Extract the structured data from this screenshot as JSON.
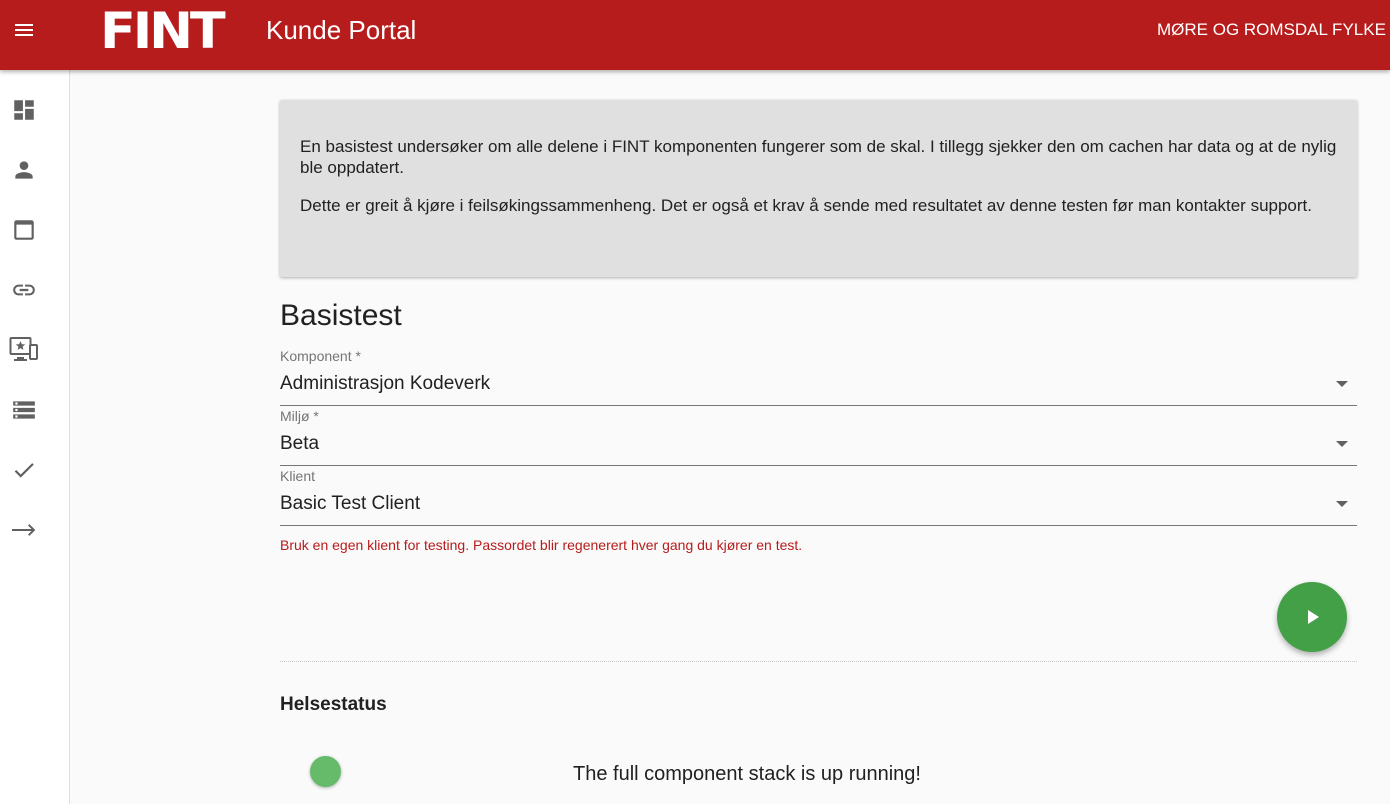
{
  "header": {
    "logo_text": "FINT",
    "title": "Kunde Portal",
    "organization": "MØRE OG ROMSDAL FYLKE",
    "background_color": "#b71c1c"
  },
  "sidebar": {
    "items": [
      {
        "icon": "dashboard-icon"
      },
      {
        "icon": "person-icon"
      },
      {
        "icon": "window-icon"
      },
      {
        "icon": "link-icon"
      },
      {
        "icon": "featured-play-list-icon"
      },
      {
        "icon": "storage-icon"
      },
      {
        "icon": "check-icon"
      },
      {
        "icon": "arrow-right-icon"
      }
    ]
  },
  "info": {
    "paragraph1": "En basistest undersøker om alle delene i FINT komponenten fungerer som de skal. I tillegg sjekker den om cachen har data og at de nylig ble oppdatert.",
    "paragraph2": "Dette er greit å kjøre i feilsøkingssammenheng. Det er også et krav å sende med resultatet av denne testen før man kontakter support."
  },
  "form": {
    "heading": "Basistest",
    "komponent": {
      "label": "Komponent *",
      "value": "Administrasjon Kodeverk"
    },
    "miljo": {
      "label": "Miljø *",
      "value": "Beta"
    },
    "klient": {
      "label": "Klient",
      "value": "Basic Test Client"
    },
    "helper_text": "Bruk en egen klient for testing. Passordet blir regenerert hver gang du kjører en test.",
    "run_button_icon": "play-icon",
    "run_button_color": "#43a047"
  },
  "health": {
    "title": "Helsestatus",
    "status_color": "#66bb6a",
    "status_text": "The full component stack is up running!"
  }
}
